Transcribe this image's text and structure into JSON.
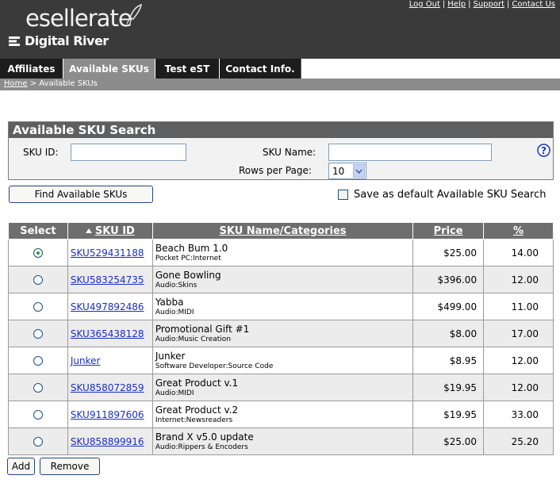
{
  "header": {
    "logo_top": "esellerate",
    "logo_bottom": "Digital River",
    "links": [
      "Log Out",
      "Help",
      "Support",
      "Contact Us"
    ]
  },
  "tabs": [
    {
      "label": "Affiliates",
      "active": false
    },
    {
      "label": "Available SKUs",
      "active": true
    },
    {
      "label": "Test eST",
      "active": false
    },
    {
      "label": "Contact Info.",
      "active": false
    }
  ],
  "breadcrumb": {
    "home": "Home",
    "separator": " > ",
    "current": "Available SKUs"
  },
  "search": {
    "title": "Available SKU Search",
    "sku_id_label": "SKU ID:",
    "sku_id_value": "",
    "sku_name_label": "SKU Name:",
    "sku_name_value": "",
    "rows_label": "Rows per Page:",
    "rows_value": "10",
    "find_button": "Find Available SKUs",
    "save_default_label": "Save as default Available SKU Search",
    "save_default_checked": false
  },
  "table": {
    "headers": {
      "select": "Select",
      "sku_id": "SKU ID",
      "name": "SKU Name/Categories",
      "price": "Price",
      "percent": "%"
    },
    "rows": [
      {
        "selected": true,
        "sku_id": "SKU529431188",
        "name": "Beach Bum 1.0",
        "category": "Pocket PC:Internet",
        "price": "$25.00",
        "percent": "14.00"
      },
      {
        "selected": false,
        "sku_id": "SKU583254735",
        "name": "Gone Bowling",
        "category": "Audio:Skins",
        "price": "$396.00",
        "percent": "12.00"
      },
      {
        "selected": false,
        "sku_id": "SKU497892486",
        "name": "Yabba",
        "category": "Audio:MIDI",
        "price": "$499.00",
        "percent": "11.00"
      },
      {
        "selected": false,
        "sku_id": "SKU365438128",
        "name": "Promotional Gift #1",
        "category": "Audio:Music Creation",
        "price": "$8.00",
        "percent": "17.00"
      },
      {
        "selected": false,
        "sku_id": "Junker",
        "name": "Junker",
        "category": "Software Developer:Source Code",
        "price": "$8.95",
        "percent": "12.00"
      },
      {
        "selected": false,
        "sku_id": "SKU858072859",
        "name": "Great Product v.1",
        "category": "Audio:MIDI",
        "price": "$19.95",
        "percent": "12.00"
      },
      {
        "selected": false,
        "sku_id": "SKU911897606",
        "name": "Great Product v.2",
        "category": "Internet:Newsreaders",
        "price": "$19.95",
        "percent": "33.00"
      },
      {
        "selected": false,
        "sku_id": "SKU858899916",
        "name": "Brand X v5.0 update",
        "category": "Audio:Rippers & Encoders",
        "price": "$25.00",
        "percent": "25.20"
      }
    ]
  },
  "actions": {
    "add": "Add",
    "remove": "Remove"
  }
}
